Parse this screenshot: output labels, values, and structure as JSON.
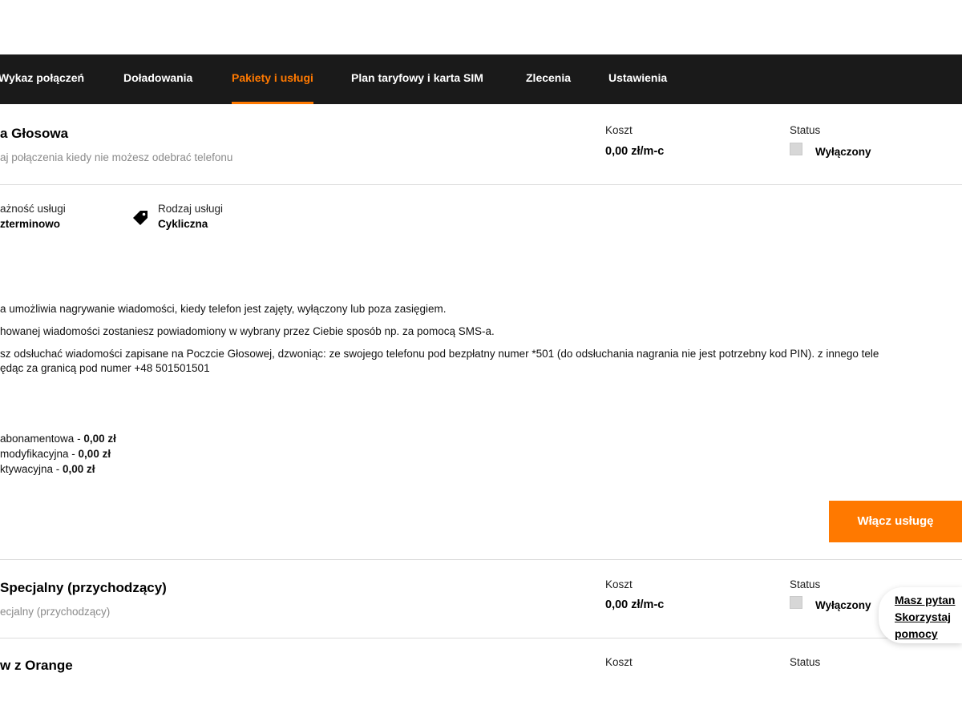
{
  "nav": {
    "tabs": [
      {
        "label": "Wykaz połączeń"
      },
      {
        "label": "Doładowania"
      },
      {
        "label": "Pakiety i usługi"
      },
      {
        "label": "Plan taryfowy i karta SIM"
      },
      {
        "label": "Zlecenia"
      },
      {
        "label": "Ustawienia"
      }
    ],
    "active_index": 2
  },
  "services": [
    {
      "title": "a Głosowa",
      "subtitle": "aj połączenia kiedy nie możesz odebrać telefonu",
      "cost_label": "Koszt",
      "cost_value": "0,00 zł/m-c",
      "status_label": "Status",
      "status_value": "Wyłączony",
      "validity_label": "ażność usługi",
      "validity_value": "zterminowo",
      "type_label": "Rodzaj usługi",
      "type_value": "Cykliczna",
      "type_icon": "tag-icon",
      "description": [
        "a umożliwia nagrywanie wiadomości, kiedy telefon jest zajęty, wyłączony lub poza zasięgiem.",
        "howanej wiadomości zostaniesz powiadomiony w wybrany przez Ciebie sposób np. za pomocą SMS-a.",
        "sz odsłuchać wiadomości zapisane na Poczcie Głosowej, dzwoniąc: ze swojego telefonu pod bezpłatny numer *501 (do odsłuchania nagrania nie jest potrzebny kod PIN). z innego tele",
        "ędąc za granicą pod numer +48 501501501"
      ],
      "fees": [
        {
          "label": "abonamentowa - ",
          "value": "0,00 zł"
        },
        {
          "label": "modyfikacyjna - ",
          "value": "0,00 zł"
        },
        {
          "label": "ktywacyjna - ",
          "value": "0,00 zł"
        }
      ],
      "enable_button": "Włącz usługę"
    },
    {
      "title": "Specjalny (przychodzący)",
      "subtitle": "ecjalny (przychodzący)",
      "cost_label": "Koszt",
      "cost_value": "0,00 zł/m-c",
      "status_label": "Status",
      "status_value": "Wyłączony"
    },
    {
      "title": "w z Orange",
      "cost_label": "Koszt",
      "status_label": "Status"
    }
  ],
  "help": {
    "line1": "Masz pytan",
    "line2": "Skorzystaj",
    "line3": "pomocy"
  },
  "colors": {
    "accent": "#ff7900",
    "nav_bg": "#1a1a1a"
  }
}
